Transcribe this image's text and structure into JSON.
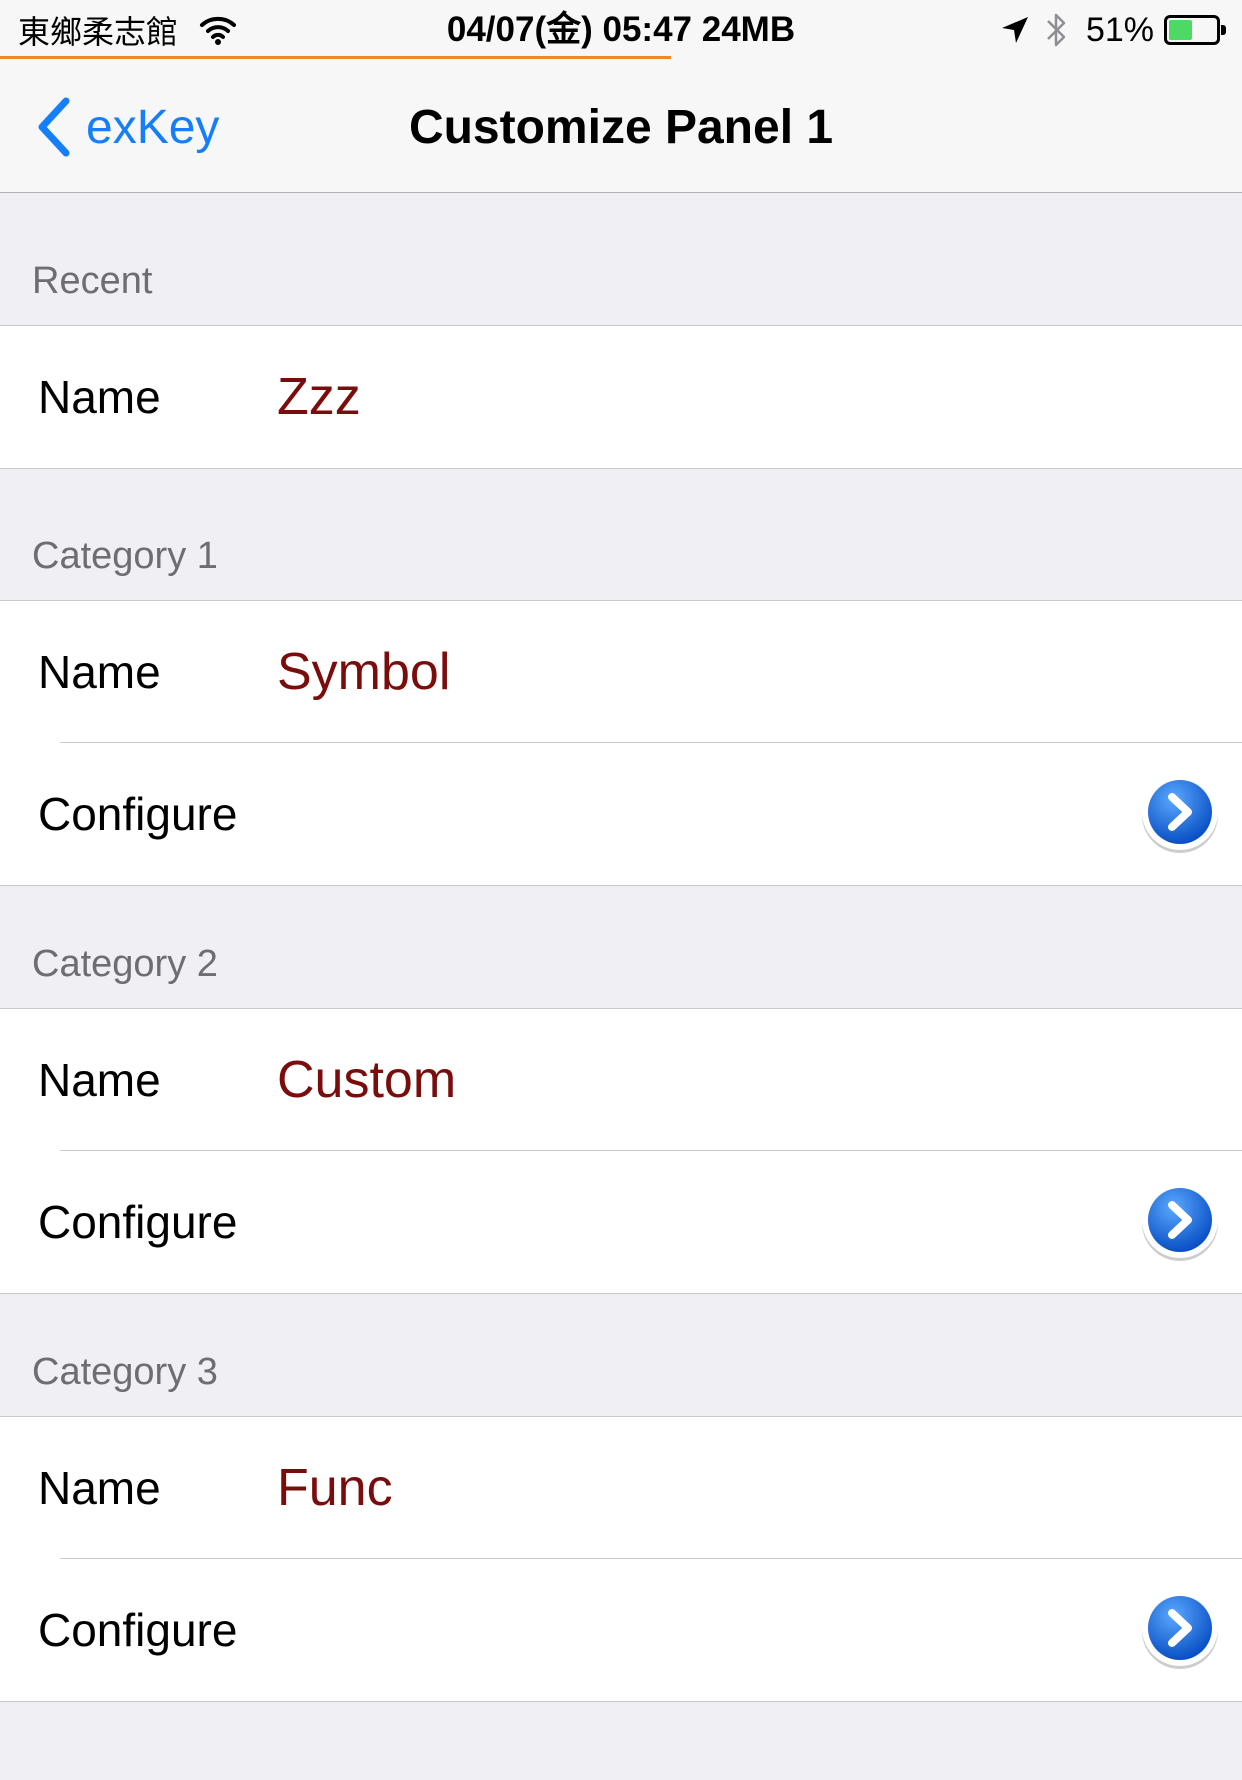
{
  "status_bar": {
    "carrier": "東鄉柔志館",
    "center_text": "04/07(金) 05:47 24MB",
    "battery_percent": "51%",
    "battery_level": 0.51,
    "progress_fraction": 0.54
  },
  "nav": {
    "back_label": "exKey",
    "title": "Customize Panel 1"
  },
  "sections": {
    "recent": {
      "header": "Recent",
      "name_label": "Name",
      "name_value": "Zzz"
    },
    "category1": {
      "header": "Category 1",
      "name_label": "Name",
      "name_value": "Symbol",
      "configure_label": "Configure"
    },
    "category2": {
      "header": "Category 2",
      "name_label": "Name",
      "name_value": "Custom",
      "configure_label": "Configure"
    },
    "category3": {
      "header": "Category 3",
      "name_label": "Name",
      "name_value": "Func",
      "configure_label": "Configure"
    }
  },
  "colors": {
    "accent": "#157efb",
    "value_text": "#7a0c0c",
    "section_header_text": "#6d6d72",
    "background": "#efeff4"
  }
}
